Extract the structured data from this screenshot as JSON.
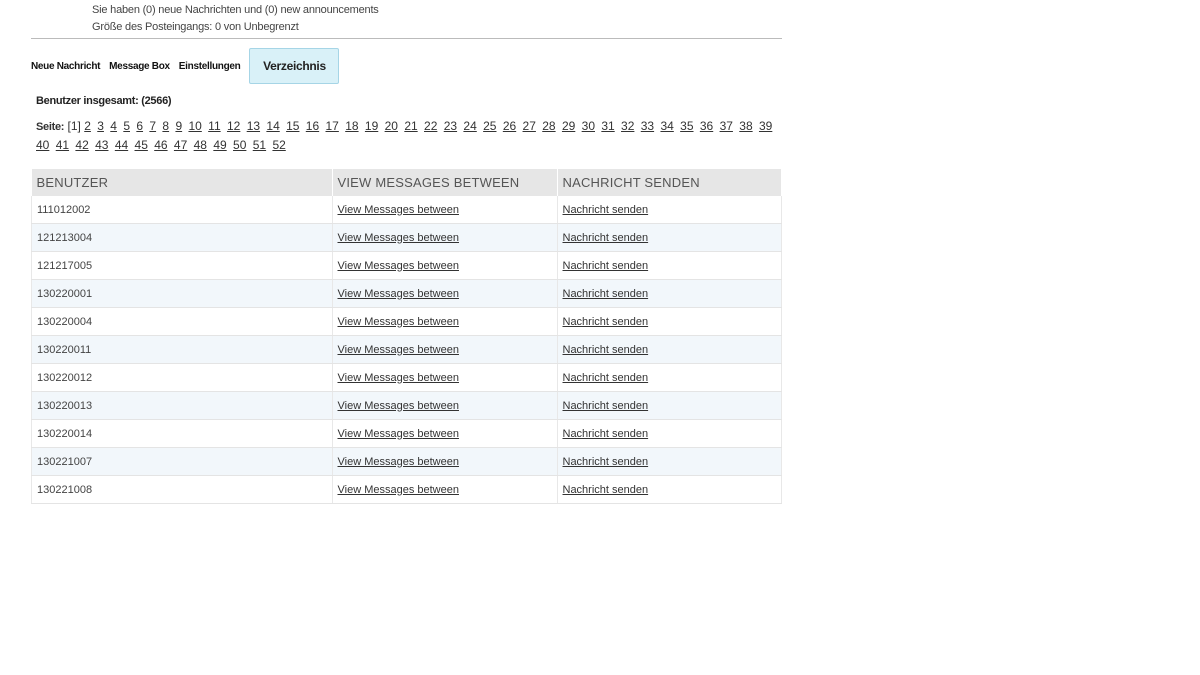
{
  "status": {
    "messages_line": "Sie haben (0) neue Nachrichten und (0) new announcements",
    "inbox_size_line": "Größe des Posteingangs: 0 von Unbegrenzt"
  },
  "tabs": {
    "new_message": "Neue Nachricht",
    "message_box": "Message Box",
    "settings": "Einstellungen",
    "directory": "Verzeichnis"
  },
  "summary": {
    "total_users": "Benutzer insgesamt: (2566)"
  },
  "pagination": {
    "label": "Seite:",
    "current": "1",
    "pages": [
      "2",
      "3",
      "4",
      "5",
      "6",
      "7",
      "8",
      "9",
      "10",
      "11",
      "12",
      "13",
      "14",
      "15",
      "16",
      "17",
      "18",
      "19",
      "20",
      "21",
      "22",
      "23",
      "24",
      "25",
      "26",
      "27",
      "28",
      "29",
      "30",
      "31",
      "32",
      "33",
      "34",
      "35",
      "36",
      "37",
      "38",
      "39",
      "40",
      "41",
      "42",
      "43",
      "44",
      "45",
      "46",
      "47",
      "48",
      "49",
      "50",
      "51",
      "52"
    ]
  },
  "table": {
    "headers": [
      "BENUTZER",
      "VIEW MESSAGES BETWEEN",
      "NACHRICHT SENDEN"
    ],
    "view_link_label": "View Messages between",
    "send_link_label": "Nachricht senden",
    "users": [
      "111012002",
      "121213004",
      "121217005",
      "130220001",
      "130220004",
      "130220011",
      "130220012",
      "130220013",
      "130220014",
      "130221007",
      "130221008"
    ]
  }
}
